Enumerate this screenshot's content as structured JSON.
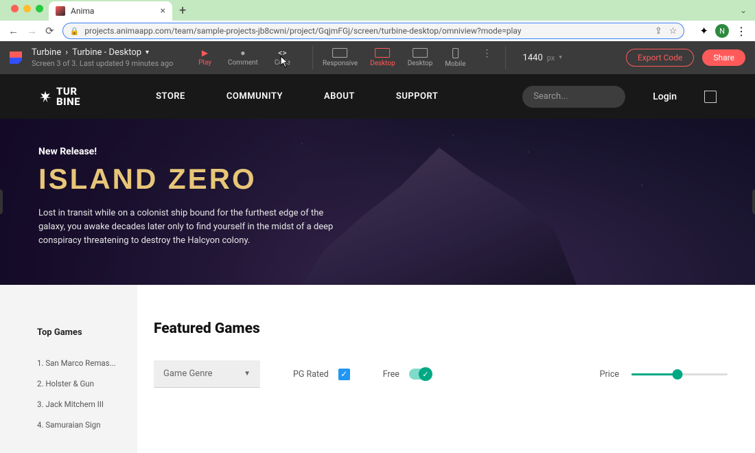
{
  "browser": {
    "tab_title": "Anima",
    "url": "projects.animaapp.com/team/sample-projects-jb8cwni/project/GqjmFGj/screen/turbine-desktop/omniview?mode=play",
    "avatar_letter": "N"
  },
  "anima": {
    "project": "Turbine",
    "screen": "Turbine - Desktop",
    "status": "Screen 3 of 3. Last updated 9 minutes ago",
    "modes": {
      "play": "Play",
      "comment": "Comment",
      "code": "Code"
    },
    "devices": {
      "responsive": "Responsive",
      "desktop1": "Desktop",
      "desktop2": "Desktop",
      "mobile": "Mobile"
    },
    "zoom_value": "1440",
    "zoom_unit": "px",
    "export_label": "Export Code",
    "share_label": "Share"
  },
  "site": {
    "logo_line1": "TUR",
    "logo_line2": "BINE",
    "nav": {
      "store": "STORE",
      "community": "COMMUNITY",
      "about": "ABOUT",
      "support": "SUPPORT"
    },
    "search_placeholder": "Search...",
    "login": "Login"
  },
  "hero": {
    "badge": "New Release!",
    "title": "ISLAND ZERO",
    "description": "Lost in transit while on a colonist ship bound for the furthest edge of the galaxy, you awake decades later only to find yourself in the midst of a deep conspiracy threatening to destroy the Halcyon colony."
  },
  "sidebar": {
    "title": "Top Games",
    "items": [
      "1. San Marco Remas...",
      "2. Holster & Gun",
      "3. Jack Mitchem III",
      "4. Samuraian Sign"
    ]
  },
  "featured": {
    "title": "Featured Games",
    "genre_label": "Game Genre",
    "pg_label": "PG Rated",
    "free_label": "Free",
    "price_label": "Price"
  }
}
